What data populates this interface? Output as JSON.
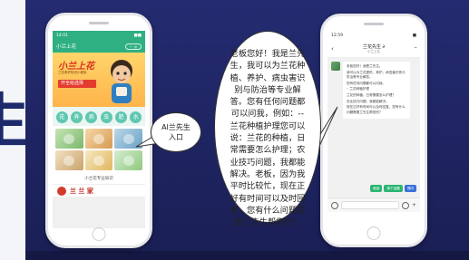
{
  "slide": {
    "edge_char": "生",
    "background": "#242b70"
  },
  "left_phone": {
    "status": {
      "time": "14:01",
      "battery": "■■"
    },
    "app_title": "小兰上花",
    "capsule": "··· ◎",
    "banner": {
      "title": "小兰上花",
      "tagline": "兰花养护知识小程序",
      "ribbon": "开全给选择"
    },
    "icons": [
      "花",
      "养",
      "病",
      "虫",
      "肥",
      "水"
    ],
    "section_title": "小兰花专业知识",
    "brand": "兰 兰 家"
  },
  "right_phone": {
    "status": {
      "time": "12:59",
      "battery": "■"
    },
    "header": {
      "back": "‹",
      "name": "兰花先生 ∂",
      "sub": "小兰上花",
      "more": "···"
    },
    "bubble_lines": [
      "老板您好！我是兰先生。",
      "我可以为兰花提供，养护，病虫害识别与防治等专业解答。",
      "您有任何问题都可以问我。",
      "",
      "·· 兰花种植护理",
      "兰花的种植，日常需要怎么护理？",
      "",
      "农业技巧问题，我都能解决。",
      "现在正好有时间可以及时回复，您有什么问题需要兰先生帮您的？"
    ],
    "actions": [
      "继续",
      "换个话题",
      "提问"
    ],
    "composer": {
      "voice": "",
      "emoji": "",
      "plus": "+"
    }
  },
  "callouts": {
    "small": "AI兰先生\n入口",
    "big": "老板您好！我是兰先生，我可以为兰花种植、养护、病虫害识别与防治等专业解答。您有任何问题都可以问我，例如：--兰花种植护理您可以说：兰花的种植，日常需要怎么护理；农业技巧问题，我都能解决。老板，因为我平时比较忙，现在正好有时间可以及时回复，您有什么问题需要兰先生帮您的？"
  }
}
